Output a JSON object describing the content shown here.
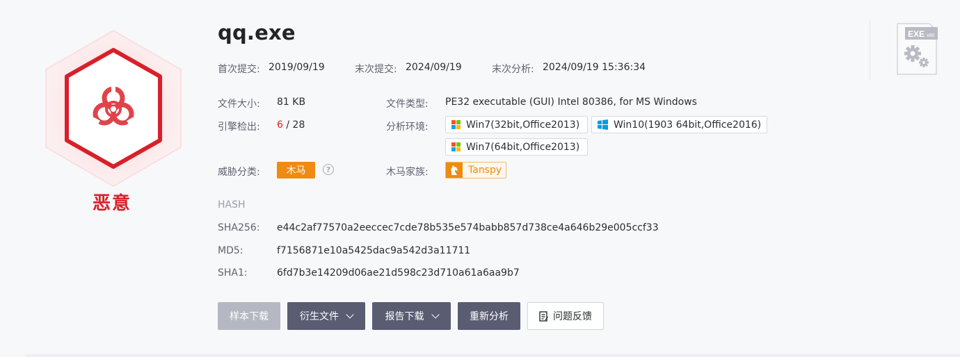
{
  "file": {
    "name": "qq.exe"
  },
  "verdict": {
    "label": "恶意",
    "color": "#d9202a"
  },
  "submission": {
    "first_label": "首次提交:",
    "first_value": "2019/09/19",
    "last_label": "末次提交:",
    "last_value": "2024/09/19",
    "analysis_label": "末次分析:",
    "analysis_value": "2024/09/19 15:36:34"
  },
  "details": {
    "size_label": "文件大小:",
    "size_value": "81 KB",
    "type_label": "文件类型:",
    "type_value": "PE32 executable (GUI) Intel 80386, for MS Windows",
    "engine_label": "引擎检出:",
    "engine_detected": "6",
    "engine_sep": " / ",
    "engine_total": "28",
    "env_label": "分析环境:",
    "environments": [
      {
        "label": "Win7(32bit,Office2013)",
        "icon": "windows7-icon"
      },
      {
        "label": "Win10(1903 64bit,Office2016)",
        "icon": "windows10-icon"
      },
      {
        "label": "Win7(64bit,Office2013)",
        "icon": "windows7-icon"
      }
    ],
    "threat_label": "威胁分类:",
    "threat_value": "木马",
    "family_label": "木马家族:",
    "family_value": "Tanspy"
  },
  "hash": {
    "heading": "HASH",
    "sha256_label": "SHA256:",
    "sha256_value": "e44c2af77570a2eeccec7cde78b535e574babb857d738ce4a646b29e005ccf33",
    "md5_label": "MD5:",
    "md5_value": "f7156871e10a5425dac9a542d3a11711",
    "sha1_label": "SHA1:",
    "sha1_value": "6fd7b3e14209d06ae21d598c23d710a61a6aa9b7"
  },
  "actions": {
    "download_sample": "样本下载",
    "derived_files": "衍生文件",
    "report_download": "报告下载",
    "reanalyze": "重新分析",
    "feedback": "问题反馈"
  },
  "file_icon": {
    "badge": "EXE",
    "arch": "x86"
  },
  "colors": {
    "accent_orange": "#ef8a12",
    "danger": "#d9202a",
    "button_dark": "#5a5d72"
  }
}
